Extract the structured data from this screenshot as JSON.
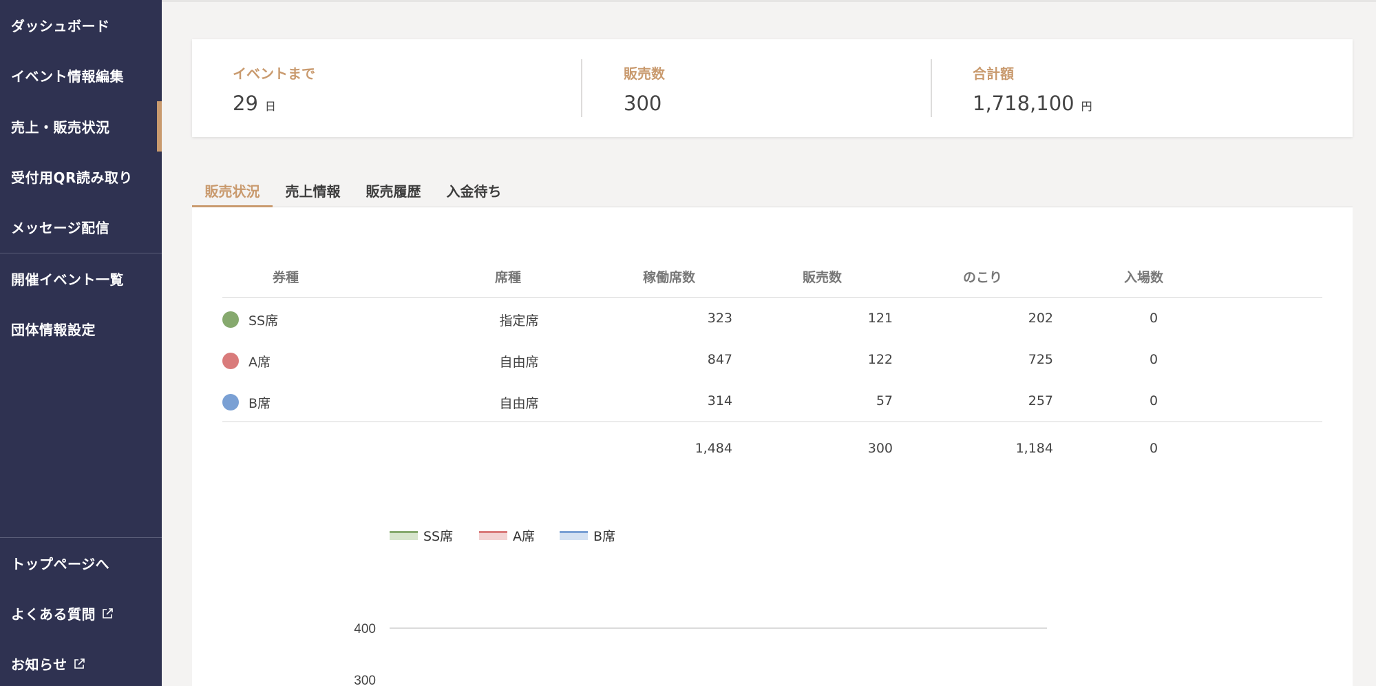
{
  "sidebar": {
    "items": [
      {
        "label": "ダッシュボード"
      },
      {
        "label": "イベント情報編集"
      },
      {
        "label": "売上・販売状況"
      },
      {
        "label": "受付用QR読み取り"
      },
      {
        "label": "メッセージ配信"
      },
      {
        "label": "開催イベント一覧"
      },
      {
        "label": "団体情報設定"
      }
    ],
    "bottom": [
      {
        "label": "トップページへ"
      },
      {
        "label": "よくある質問"
      },
      {
        "label": "お知らせ"
      }
    ]
  },
  "stats": {
    "days": {
      "label": "イベントまで",
      "value": "29",
      "unit": "日"
    },
    "sold": {
      "label": "販売数",
      "value": "300"
    },
    "total": {
      "label": "合計額",
      "value": "1,718,100",
      "unit": "円"
    }
  },
  "tabs": [
    {
      "label": "販売状況"
    },
    {
      "label": "売上情報"
    },
    {
      "label": "販売履歴"
    },
    {
      "label": "入金待ち"
    }
  ],
  "table": {
    "headers": [
      "券種",
      "席種",
      "稼働席数",
      "販売数",
      "のこり",
      "入場数"
    ],
    "rows": [
      {
        "name": "SS席",
        "seat": "指定席",
        "capacity": "323",
        "sold": "121",
        "remaining": "202",
        "entered": "0",
        "color": "#86a96e"
      },
      {
        "name": "A席",
        "seat": "自由席",
        "capacity": "847",
        "sold": "122",
        "remaining": "725",
        "entered": "0",
        "color": "#d97b7b"
      },
      {
        "name": "B席",
        "seat": "自由席",
        "capacity": "314",
        "sold": "57",
        "remaining": "257",
        "entered": "0",
        "color": "#7aa0d4"
      }
    ],
    "totals": {
      "capacity": "1,484",
      "sold": "300",
      "remaining": "1,184",
      "entered": "0"
    }
  },
  "chart_data": {
    "type": "line",
    "series": [
      {
        "name": "SS席",
        "color": "#86a96e"
      },
      {
        "name": "A席",
        "color": "#d97b7b"
      },
      {
        "name": "B席",
        "color": "#7aa0d4"
      }
    ],
    "yticks": [
      "400"
    ],
    "legend_position": "top-left"
  }
}
